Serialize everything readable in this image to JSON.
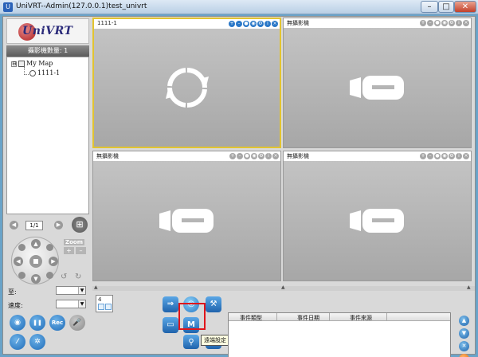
{
  "window": {
    "title": "UniVRT--Admin(127.0.0.1)test_univrt",
    "minimize_label": "–",
    "maximize_label": "□",
    "close_label": "✕"
  },
  "sidebar": {
    "logo_text": "UniVRT",
    "camera_count_label": "攝影機數量: 1",
    "tree": {
      "root_expander": "⊟",
      "root_label": "My Map",
      "camera_label": "1111-1"
    },
    "pager": {
      "prev": "◀",
      "page": "1/1",
      "next": "▶"
    },
    "ptz": {
      "up": "▲",
      "down": "▼",
      "left": "◀",
      "right": "▶",
      "zoom_label": "Zoom",
      "zoom_in": "+",
      "zoom_out": "–"
    },
    "field1_label": "至:",
    "field2_label": "速度:",
    "controls": {
      "snapshot": "◉",
      "pause": "❚❚",
      "rec": "Rec",
      "mic": "🎤",
      "mute": "⁄",
      "network": "✲"
    }
  },
  "video_tiles": [
    {
      "name": "1111-1",
      "state": "connecting"
    },
    {
      "name": "無攝影機",
      "state": "no-camera"
    },
    {
      "name": "無攝影機",
      "state": "no-camera"
    },
    {
      "name": "無攝影機",
      "state": "no-camera"
    }
  ],
  "bottom": {
    "layout_number": "4",
    "tooltip": "遠端設定",
    "event_columns": [
      "事件類型",
      "事件日期",
      "事件來源"
    ],
    "icon_letters": {
      "m": "M"
    }
  },
  "colors": {
    "selected_tile_border": "#e2c430",
    "highlight_box": "#e0151b",
    "accent_blue": "#1e6bb8",
    "alert_orange": "#e96a05"
  }
}
